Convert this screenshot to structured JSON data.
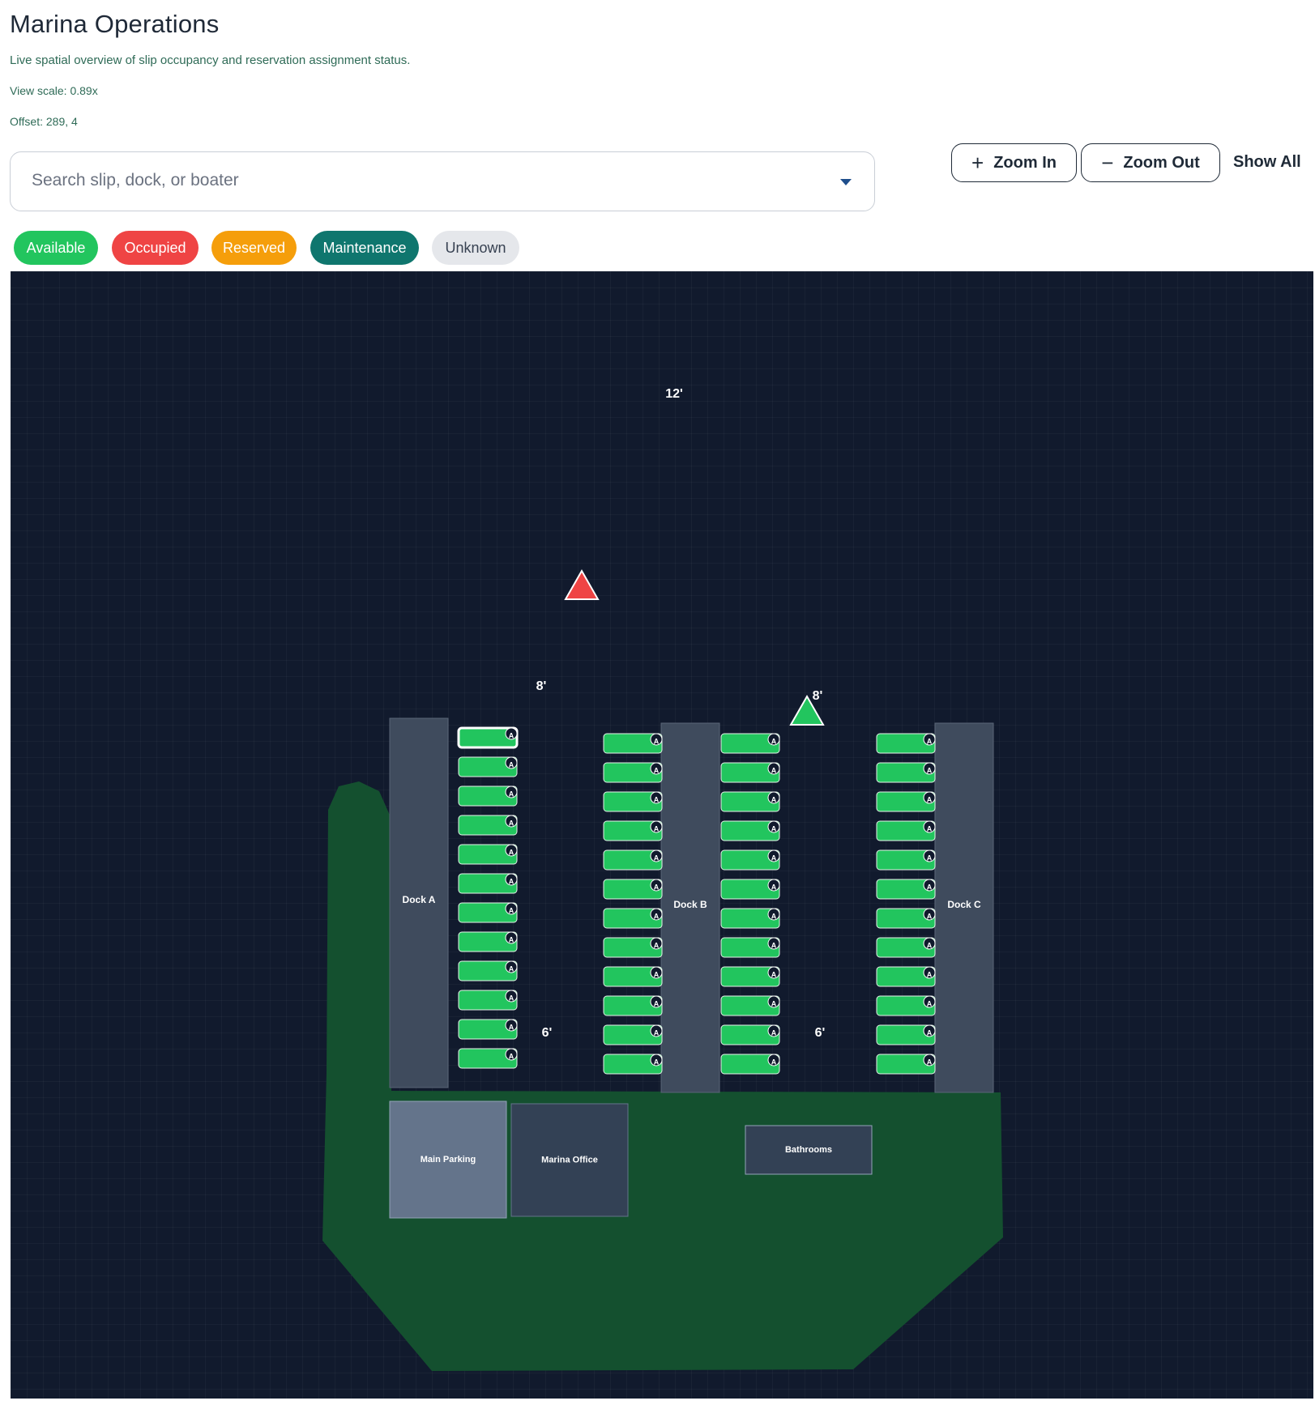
{
  "header": {
    "title": "Marina Operations",
    "subtitle": "Live spatial overview of slip occupancy and reservation assignment status.",
    "view_scale": "View scale: 0.89x",
    "offset": "Offset: 289, 4"
  },
  "search": {
    "placeholder": "Search slip, dock, or boater",
    "value": ""
  },
  "toolbar": {
    "zoom_in_label": "Zoom In",
    "zoom_out_label": "Zoom Out",
    "show_all_label": "Show All",
    "zoom_in_icon": "plus-icon",
    "zoom_out_icon": "minus-icon"
  },
  "legend": [
    {
      "label": "Available",
      "color": "#22c55e",
      "text_color": "#ffffff"
    },
    {
      "label": "Occupied",
      "color": "#ef4444",
      "text_color": "#ffffff"
    },
    {
      "label": "Reserved",
      "color": "#f59e0b",
      "text_color": "#ffffff"
    },
    {
      "label": "Maintenance",
      "color": "#0f766e",
      "text_color": "#ffffff"
    },
    {
      "label": "Unknown",
      "color": "#e5e7eb",
      "text_color": "#374151"
    }
  ],
  "map": {
    "background_color": "#111a2d",
    "land_color": "#14502f",
    "dock_color": "#3f4b5d",
    "slip_color": "#22c55e",
    "docks": [
      {
        "label": "Dock A",
        "slips": 12,
        "sides": [
          "right"
        ]
      },
      {
        "label": "Dock B",
        "slips": 12,
        "sides": [
          "left",
          "right"
        ]
      },
      {
        "label": "Dock C",
        "slips": 12,
        "sides": [
          "left"
        ]
      }
    ],
    "slip_badge": "A",
    "buildings": [
      {
        "label": "Main Parking",
        "color": "#64748b"
      },
      {
        "label": "Marina Office",
        "color": "#334155"
      },
      {
        "label": "Bathrooms",
        "color": "#334155"
      }
    ],
    "dimension_labels": [
      "12'",
      "8'",
      "8'",
      "6'",
      "6'"
    ],
    "markers": [
      {
        "type": "triangle",
        "color": "#ef4444"
      },
      {
        "type": "triangle",
        "color": "#22c55e"
      }
    ]
  }
}
